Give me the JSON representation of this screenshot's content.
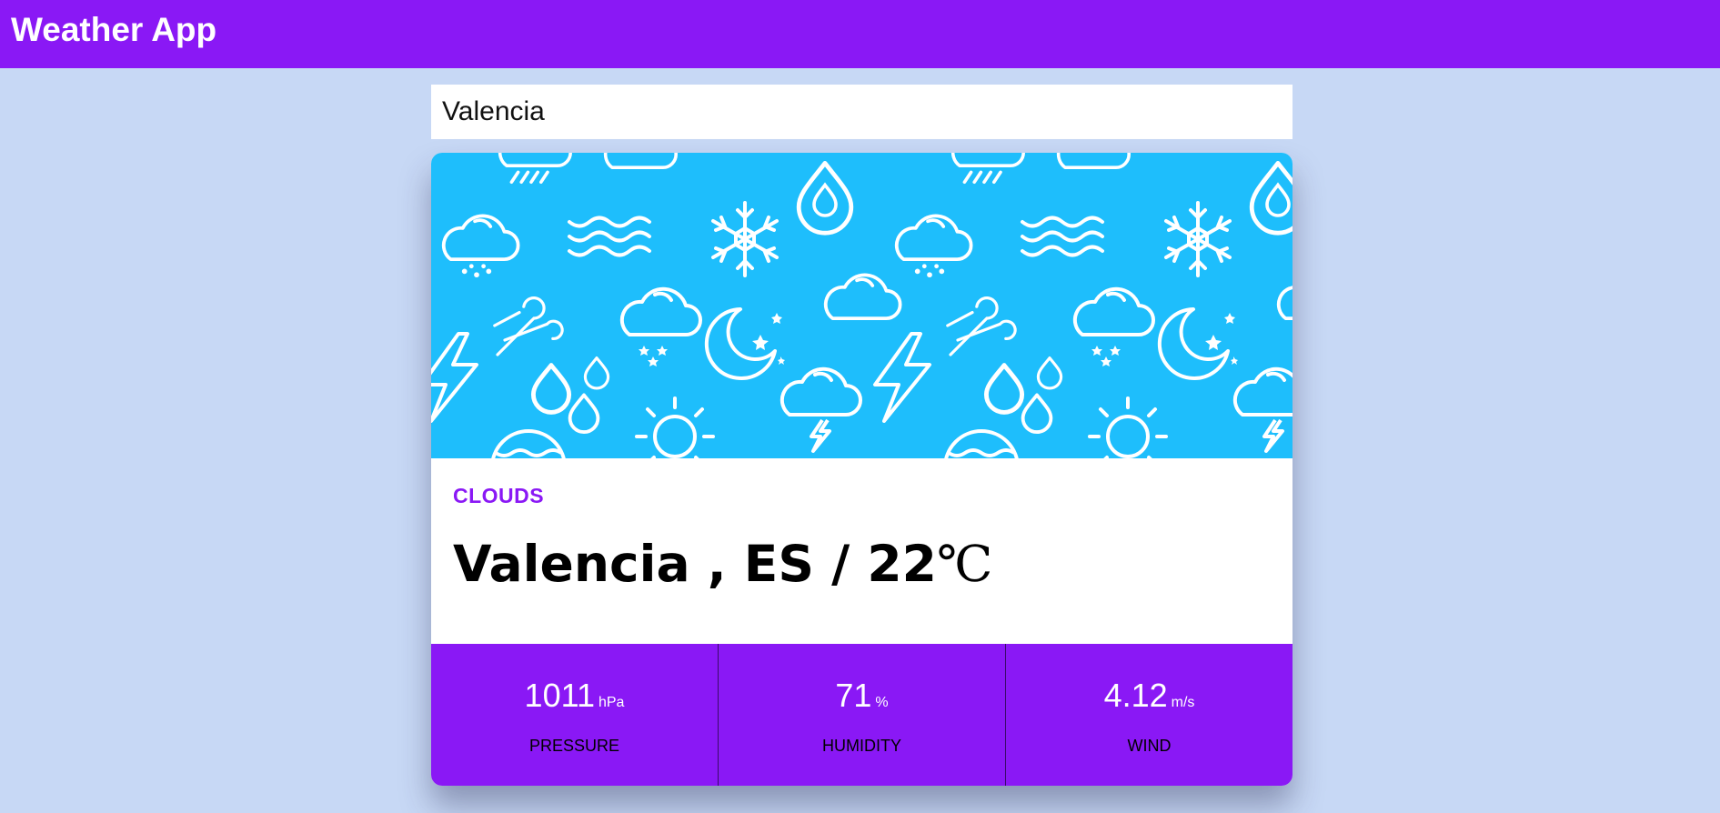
{
  "app": {
    "title": "Weather App"
  },
  "search": {
    "value": "Valencia"
  },
  "weather": {
    "condition": "CLOUDS",
    "city": "Valencia",
    "country": "ES",
    "temperature": "22",
    "temp_unit": "℃"
  },
  "stats": [
    {
      "value": "1011",
      "unit": "hPa",
      "label": "PRESSURE"
    },
    {
      "value": "71",
      "unit": "%",
      "label": "HUMIDITY"
    },
    {
      "value": "4.12",
      "unit": "m/s",
      "label": "WIND"
    }
  ],
  "colors": {
    "accent": "#8a18f5",
    "page_background": "#c7d8f5",
    "banner_background": "#1ebefc",
    "card_background": "#ffffff"
  },
  "icons": [
    "weather-pattern-banner"
  ]
}
